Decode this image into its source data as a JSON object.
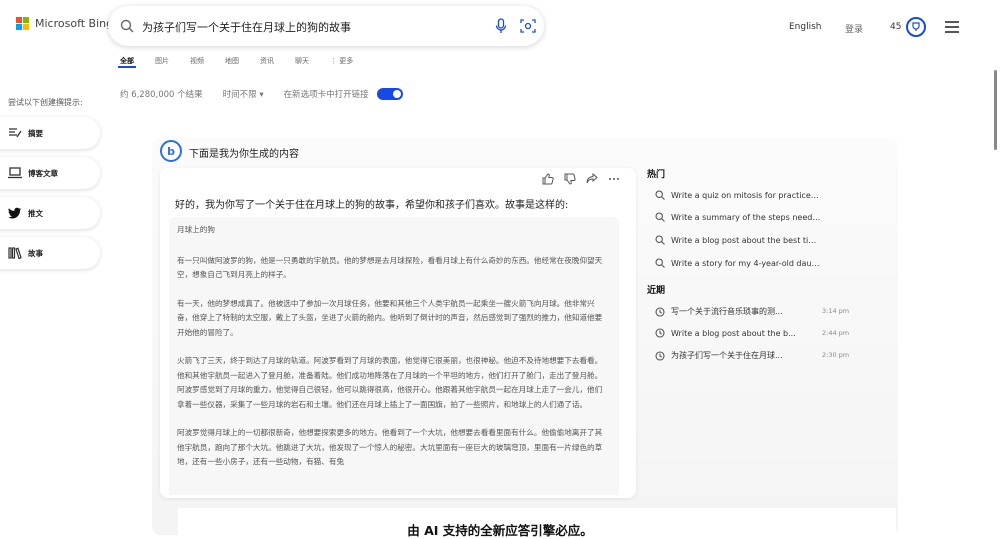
{
  "header": {
    "brand": "Microsoft Bing",
    "brand_colors": [
      "#f25022",
      "#7fba00",
      "#00a4ef",
      "#ffb900"
    ],
    "query": "为孩子们写一个关于住在月球上的狗的故事",
    "language": "English",
    "login": "登录",
    "reward_count": "45",
    "accent": "#174ae4"
  },
  "tabs": [
    "全部",
    "图片",
    "视频",
    "地图",
    "资讯",
    "聊天",
    "⋮ 更多"
  ],
  "stats": {
    "results": "约 6,280,000 个结果",
    "time_filter": "时间不限 ▾",
    "new_tab": "在新选项卡中打开链接"
  },
  "left_panel": {
    "title": "尝试以下创建撰提示:",
    "items": [
      {
        "label": "摘要",
        "icon": "summary-icon"
      },
      {
        "label": "博客文章",
        "icon": "laptop-icon"
      },
      {
        "label": "推文",
        "icon": "twitter-icon"
      },
      {
        "label": "故事",
        "icon": "books-icon"
      }
    ]
  },
  "chat": {
    "generated_label": "下面是我为你生成的内容",
    "intro": "好的，我为你写了一个关于住在月球上的狗的故事，希望你和孩子们喜欢。故事是这样的:",
    "story_title": "月球上的狗",
    "paragraphs": [
      "有一只叫做阿波罗的狗，他是一只勇敢的宇航员。他的梦想是去月球探险，看看月球上有什么奇妙的东西。他经常在夜晚仰望天空，想象自己飞到月亮上的样子。",
      "有一天，他的梦想成真了。他被选中了参加一次月球任务，他要和其他三个人类宇航员一起乘坐一艘火箭飞向月球。他非常兴奋，他穿上了特制的太空服，戴上了头盔，坐进了火箭的舱内。他听到了倒计时的声音，然后感觉到了强烈的推力，他知道他要开始他的冒险了。",
      "火箭飞了三天，终于到达了月球的轨道。阿波罗看到了月球的表面，他觉得它很美丽，也很神秘。他迫不及待地想要下去看看。他和其他宇航员一起进入了登月舱，准备着陆。他们成功地降落在了月球的一个平坦的地方，他们打开了舱门，走出了登月舱。阿波罗感觉到了月球的重力，他觉得自己很轻，他可以跳得很高，他很开心。他跟着其他宇航员一起在月球上走了一会儿，他们拿着一些仪器，采集了一些月球的岩石和土壤。他们还在月球上插上了一面国旗，拍了一些照片，和地球上的人们通了话。",
      "阿波罗觉得月球上的一切都很新奇，他想要探索更多的地方。他看到了一个大坑，他想要去看看里面有什么。他偷偷地离开了其他宇航员，跑向了那个大坑。他跳进了大坑，他发现了一个惊人的秘密。大坑里面有一座巨大的玻璃穹顶，里面有一片绿色的草地，还有一些小房子，还有一些动物，有猫、有兔"
    ],
    "tagline": "由 AI 支持的全新应答引擎必应。"
  },
  "right_panel": {
    "popular_title": "热门",
    "popular": [
      "Write a quiz on mitosis for practice. Provi...",
      "Write a summary of the steps needed to s...",
      "Write a blog post about the best tips and ...",
      "Write a story for my 4-year-old daughter ..."
    ],
    "recent_title": "近期",
    "recent": [
      {
        "text": "写一个关于流行音乐琐事的测...",
        "time": "3:14 pm"
      },
      {
        "text": "Write a blog post about the b...",
        "time": "2:44 pm"
      },
      {
        "text": "为孩子们写一个关于住在月球...",
        "time": "2:30 pm"
      }
    ]
  }
}
